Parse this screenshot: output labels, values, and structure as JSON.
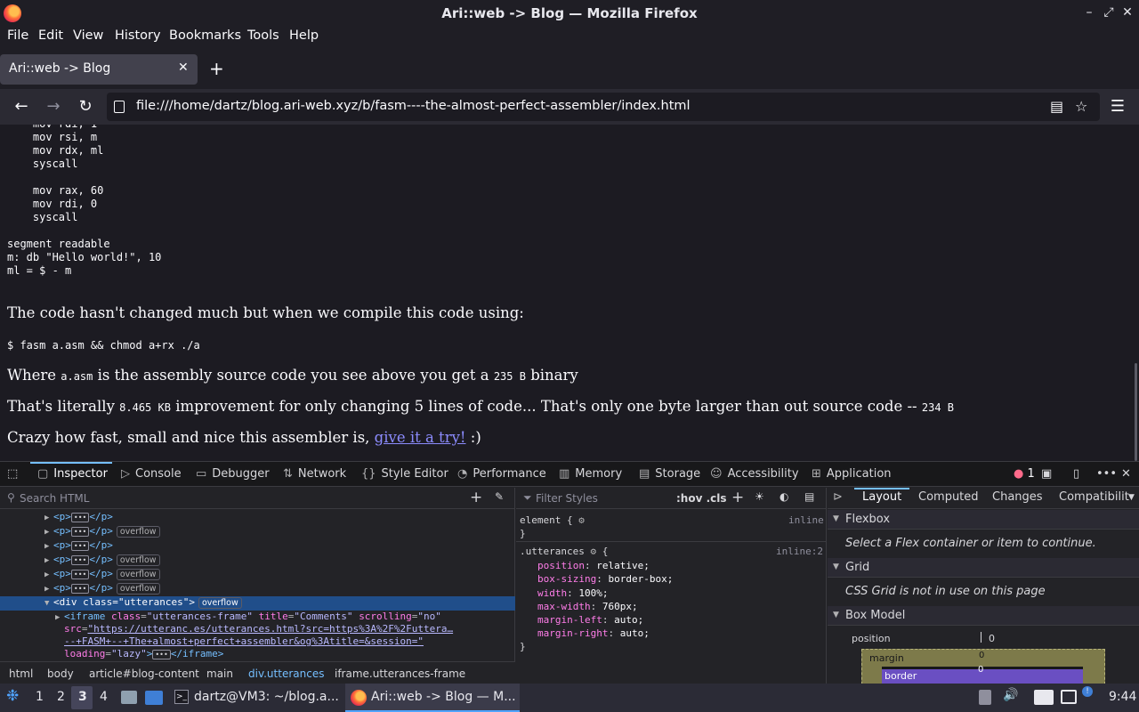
{
  "window": {
    "title": "Ari::web -> Blog — Mozilla Firefox",
    "minimize": "–",
    "maximize": "⤢",
    "close": "✕"
  },
  "menubar": {
    "file": "File",
    "edit": "Edit",
    "view": "View",
    "history": "History",
    "bookmarks": "Bookmarks",
    "tools": "Tools",
    "help": "Help"
  },
  "tab": {
    "label": "Ari::web -> Blog",
    "close": "✕",
    "newtab": "+"
  },
  "nav": {
    "back": "←",
    "forward": "→",
    "reload": "↻",
    "url": "file:///home/dartz/blog.ari-web.xyz/b/fasm----the-almost-perfect-assembler/index.html",
    "menu": "☰",
    "star": "☆",
    "reader": "▤"
  },
  "page": {
    "code_block": "    mov rdi, 1\n    mov rsi, m\n    mov rdx, ml\n    syscall\n\n    mov rax, 60\n    mov rdi, 0\n    syscall\n\nsegment readable\nm: db \"Hello world!\", 10\nml = $ - m",
    "p1": "The code hasn't changed much but when we compile this code using:",
    "cmd": "$ fasm a.asm && chmod a+rx ./a",
    "p2_a": "Where ",
    "p2_code1": "a.asm",
    "p2_b": " is the assembly source code you see above you get a ",
    "p2_code2": "235 B",
    "p2_c": " binary",
    "p3_a": "That's literally ",
    "p3_code1": "8.465 KB",
    "p3_b": " improvement for only changing 5 lines of code... That's only one byte larger than out source code -- ",
    "p3_code2": "234 B",
    "p4_a": "Crazy how fast, small and nice this assembler is, ",
    "p4_link": "give it a try!",
    "p4_b": " :)"
  },
  "devtools": {
    "tabs": {
      "inspector": "Inspector",
      "console": "Console",
      "debugger": "Debugger",
      "network": "Network",
      "style_editor": "Style Editor",
      "performance": "Performance",
      "memory": "Memory",
      "storage": "Storage",
      "accessibility": "Accessibility",
      "application": "Application"
    },
    "error_count": "1",
    "search_placeholder": "Search HTML",
    "filter_placeholder": "Filter Styles",
    "hov_cls": ":hov .cls",
    "markup": {
      "overflow": "overflow",
      "p_tag": "<p>",
      "p_close": "</p>",
      "div_open": "<div",
      "div_class_attr": "class",
      "div_class_val": "\"utterances\"",
      "iframe_open": "<iframe",
      "iframe_class": "class",
      "iframe_class_val": "\"utterances-frame\"",
      "iframe_title": "title",
      "iframe_title_val": "\"Comments\"",
      "iframe_scrolling": "scrolling",
      "iframe_scrolling_val": "\"no\"",
      "src_attr": "src",
      "src_val1": "\"https://utteranc.es/utterances.html?src=https%3A%2F%2Futtera…",
      "src_val2": "--+FASM+--+The+almost+perfect+assembler&og%3Atitle=&session=\"",
      "loading_attr": "loading",
      "loading_val": "\"lazy\"",
      "iframe_close": "</iframe>",
      "ellipsis": "…"
    },
    "breadcrumbs": [
      "html",
      "body",
      "article#blog-content",
      "main",
      "div.utterances",
      "iframe.utterances-frame"
    ],
    "rules": {
      "element_sel": "element {",
      "element_src": "inline",
      "close": "}",
      "utter_sel": ".utterances",
      "utter_src": "inline:2",
      "open": "{",
      "decls": [
        {
          "p": "position",
          "v": "relative;"
        },
        {
          "p": "box-sizing",
          "v": "border-box;"
        },
        {
          "p": "width",
          "v": "100%;"
        },
        {
          "p": "max-width",
          "v": "760px;"
        },
        {
          "p": "margin-left",
          "v": "auto;"
        },
        {
          "p": "margin-right",
          "v": "auto;"
        }
      ]
    },
    "layout": {
      "tabs": {
        "layout": "Layout",
        "computed": "Computed",
        "changes": "Changes",
        "compat": "Compatibilit"
      },
      "flexbox": "Flexbox",
      "flex_hint": "Select a Flex container or item to continue.",
      "grid": "Grid",
      "grid_hint": "CSS Grid is not in use on this page",
      "boxmodel": "Box Model",
      "position": "position",
      "pos_val": "0",
      "margin": "margin",
      "margin_val": "0",
      "border": "border",
      "border_val": "0"
    }
  },
  "taskbar": {
    "ws1": "1",
    "ws2": "2",
    "ws3": "3",
    "ws4": "4",
    "terminal": "dartz@VM3: ~/blog.a...",
    "firefox": "Ari::web -> Blog — M...",
    "clock": "9:44"
  },
  "colors": {
    "accent": "#75bfff",
    "link": "#8c8cff",
    "selection": "#204e8a",
    "margin_box": "#7d7a4a",
    "border_box": "#6a4fc2"
  }
}
